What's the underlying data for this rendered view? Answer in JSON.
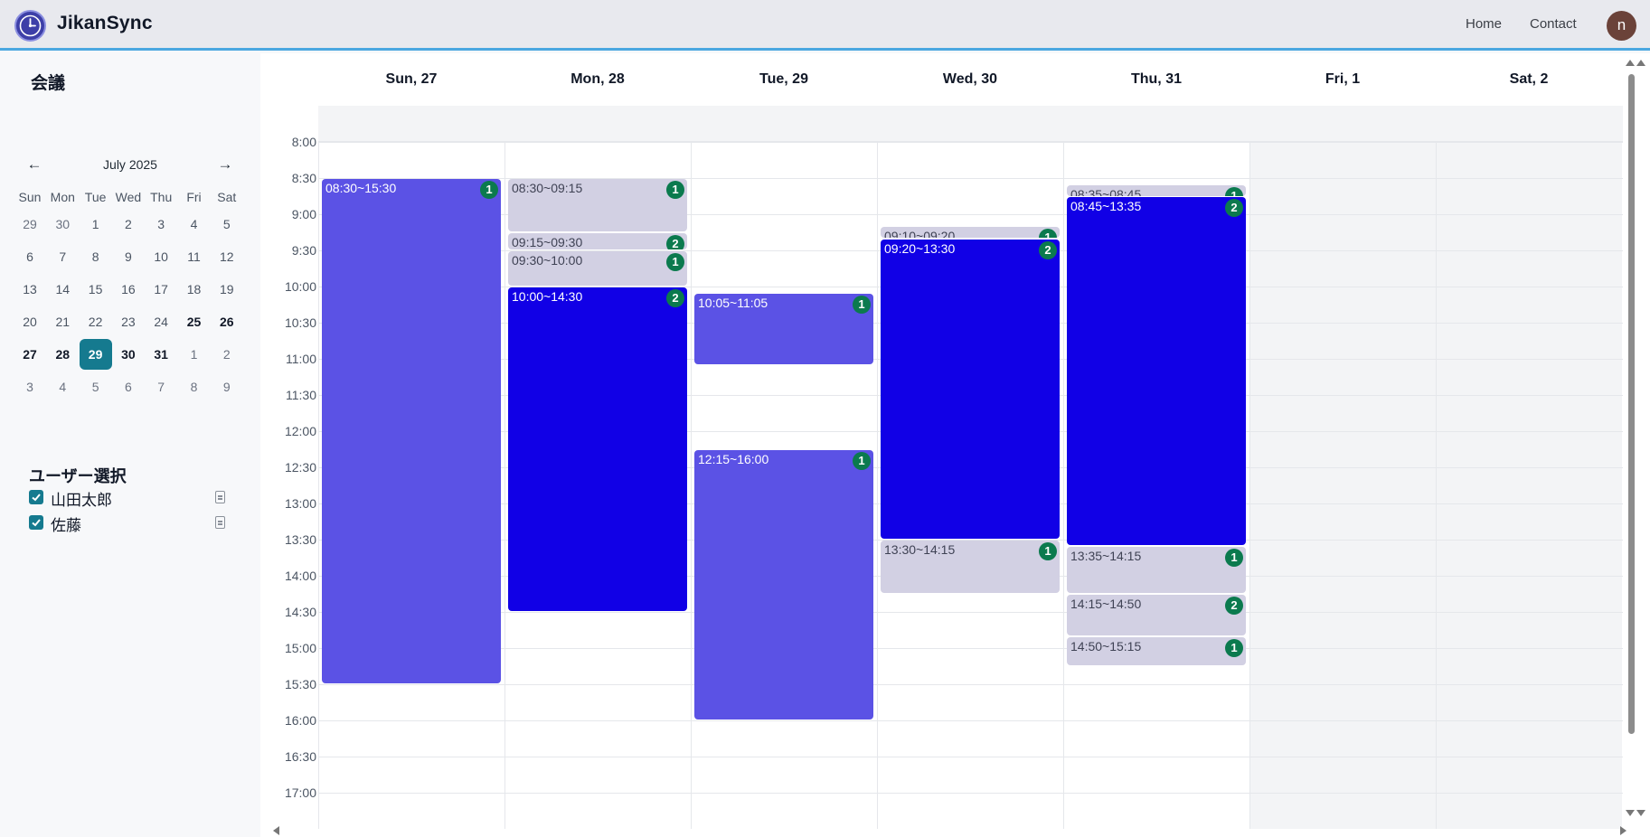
{
  "header": {
    "brand": "JikanSync",
    "nav": {
      "home": "Home",
      "contact": "Contact"
    },
    "avatar_initial": "n"
  },
  "sidebar": {
    "title": "会議",
    "calendar": {
      "month_label": "July 2025",
      "prev_icon": "←",
      "next_icon": "→",
      "weekdays": [
        "Sun",
        "Mon",
        "Tue",
        "Wed",
        "Thu",
        "Fri",
        "Sat"
      ],
      "weeks": [
        [
          "29",
          "30",
          "1",
          "2",
          "3",
          "4",
          "5"
        ],
        [
          "6",
          "7",
          "8",
          "9",
          "10",
          "11",
          "12"
        ],
        [
          "13",
          "14",
          "15",
          "16",
          "17",
          "18",
          "19"
        ],
        [
          "20",
          "21",
          "22",
          "23",
          "24",
          "25",
          "26"
        ],
        [
          "27",
          "28",
          "29",
          "30",
          "31",
          "1",
          "2"
        ],
        [
          "3",
          "4",
          "5",
          "6",
          "7",
          "8",
          "9"
        ]
      ],
      "selected": "29"
    },
    "user_section_title": "ユーザー選択",
    "users": [
      {
        "name": "山田太郎",
        "checked": true
      },
      {
        "name": "佐藤",
        "checked": true
      }
    ]
  },
  "week": {
    "days": [
      "Sun, 27",
      "Mon, 28",
      "Tue, 29",
      "Wed, 30",
      "Thu, 31",
      "Fri, 1",
      "Sat, 2"
    ],
    "times": [
      "8:00",
      "8:30",
      "9:00",
      "9:30",
      "10:00",
      "10:30",
      "11:00",
      "11:30",
      "12:00",
      "12:30",
      "13:00",
      "13:30",
      "14:00",
      "14:30",
      "15:00",
      "15:30",
      "16:00",
      "16:30",
      "17:00"
    ],
    "events": [
      {
        "day": 0,
        "start": "08:30",
        "end": "15:30",
        "label": "08:30~15:30",
        "count": "1",
        "tone": "mid"
      },
      {
        "day": 1,
        "start": "08:30",
        "end": "09:15",
        "label": "08:30~09:15",
        "count": "1",
        "tone": "light"
      },
      {
        "day": 1,
        "start": "09:15",
        "end": "09:30",
        "label": "09:15~09:30",
        "count": "2",
        "tone": "light"
      },
      {
        "day": 1,
        "start": "09:30",
        "end": "10:00",
        "label": "09:30~10:00",
        "count": "1",
        "tone": "light"
      },
      {
        "day": 1,
        "start": "10:00",
        "end": "14:30",
        "label": "10:00~14:30",
        "count": "2",
        "tone": "dark"
      },
      {
        "day": 2,
        "start": "10:05",
        "end": "11:05",
        "label": "10:05~11:05",
        "count": "1",
        "tone": "mid"
      },
      {
        "day": 2,
        "start": "12:15",
        "end": "16:00",
        "label": "12:15~16:00",
        "count": "1",
        "tone": "mid"
      },
      {
        "day": 3,
        "start": "09:10",
        "end": "09:20",
        "label": "09:10~09:20",
        "count": "1",
        "tone": "light"
      },
      {
        "day": 3,
        "start": "09:20",
        "end": "13:30",
        "label": "09:20~13:30",
        "count": "2",
        "tone": "dark"
      },
      {
        "day": 3,
        "start": "13:30",
        "end": "14:15",
        "label": "13:30~14:15",
        "count": "1",
        "tone": "light"
      },
      {
        "day": 4,
        "start": "08:35",
        "end": "08:45",
        "label": "08:35~08:45",
        "count": "1",
        "tone": "light"
      },
      {
        "day": 4,
        "start": "08:45",
        "end": "13:35",
        "label": "08:45~13:35",
        "count": "2",
        "tone": "dark"
      },
      {
        "day": 4,
        "start": "13:35",
        "end": "14:15",
        "label": "13:35~14:15",
        "count": "1",
        "tone": "light"
      },
      {
        "day": 4,
        "start": "14:15",
        "end": "14:50",
        "label": "14:15~14:50",
        "count": "2",
        "tone": "light"
      },
      {
        "day": 4,
        "start": "14:50",
        "end": "15:15",
        "label": "14:50~15:15",
        "count": "1",
        "tone": "light"
      }
    ]
  }
}
